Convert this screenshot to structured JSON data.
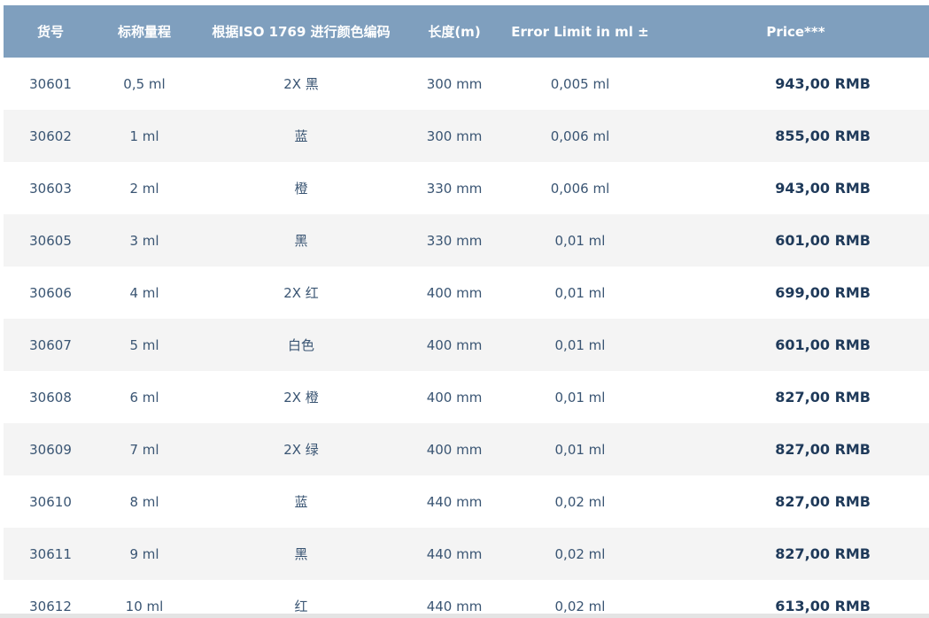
{
  "table": {
    "headers": [
      "货号",
      "标称量程",
      "根据ISO 1769 进行颜色编码",
      "长度(m)",
      "Error Limit in ml ±",
      "Price***"
    ],
    "rows": [
      [
        "30601",
        "0,5 ml",
        "2X 黑",
        "300 mm",
        "0,005 ml",
        "943,00 RMB"
      ],
      [
        "30602",
        "1 ml",
        "蓝",
        "300 mm",
        "0,006 ml",
        "855,00 RMB"
      ],
      [
        "30603",
        "2 ml",
        "橙",
        "330 mm",
        "0,006 ml",
        "943,00 RMB"
      ],
      [
        "30605",
        "3 ml",
        "黑",
        "330 mm",
        "0,01 ml",
        "601,00 RMB"
      ],
      [
        "30606",
        "4 ml",
        "2X 红",
        "400 mm",
        "0,01 ml",
        "699,00 RMB"
      ],
      [
        "30607",
        "5 ml",
        "白色",
        "400 mm",
        "0,01 ml",
        "601,00 RMB"
      ],
      [
        "30608",
        "6 ml",
        "2X 橙",
        "400 mm",
        "0,01 ml",
        "827,00 RMB"
      ],
      [
        "30609",
        "7 ml",
        "2X 绿",
        "400 mm",
        "0,01 ml",
        "827,00 RMB"
      ],
      [
        "30610",
        "8 ml",
        "蓝",
        "440 mm",
        "0,02 ml",
        "827,00 RMB"
      ],
      [
        "30611",
        "9 ml",
        "黑",
        "440 mm",
        "0,02 ml",
        "827,00 RMB"
      ],
      [
        "30612",
        "10 ml",
        "红",
        "440 mm",
        "0,02 ml",
        "613,00 RMB"
      ]
    ]
  },
  "colors": {
    "header_bg": "#7f9fbe",
    "header_text": "#ffffff",
    "row_alt_bg": "#f4f4f4",
    "cell_text": "#3a5573",
    "price_text": "#1f3a5a"
  }
}
